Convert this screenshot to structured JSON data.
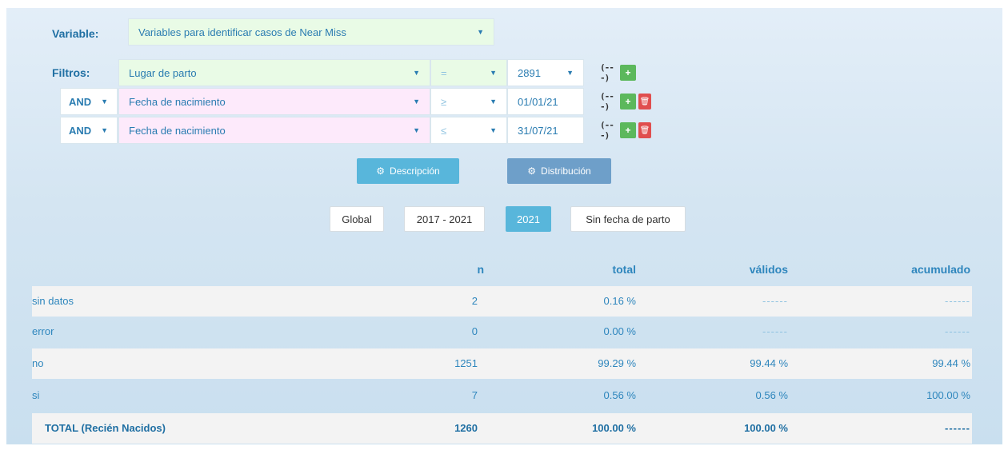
{
  "variable": {
    "label": "Variable:",
    "value": "Variables para identificar casos de Near Miss"
  },
  "filters": {
    "label": "Filtros:",
    "rows": [
      {
        "connector": "",
        "field": "Lugar de parto",
        "operator": "=",
        "value": "2891"
      },
      {
        "connector": "AND",
        "field": "Fecha de nacimiento",
        "operator": "≥",
        "value": "01/01/21"
      },
      {
        "connector": "AND",
        "field": "Fecha de nacimiento",
        "operator": "≤",
        "value": "31/07/21"
      }
    ],
    "fx_glyph": "(---)",
    "add_glyph": "+",
    "delete_glyph": "🗑"
  },
  "actions": {
    "descripcion": "Descripción",
    "distribucion": "Distribución"
  },
  "period_tabs": [
    {
      "label": "Global",
      "active": false
    },
    {
      "label": "2017 - 2021",
      "active": false
    },
    {
      "label": "2021",
      "active": true
    },
    {
      "label": "Sin fecha de parto",
      "active": false
    }
  ],
  "table": {
    "headers": {
      "n": "n",
      "total": "total",
      "validos": "válidos",
      "acumulado": "acumulado"
    },
    "rows": [
      {
        "label": "sin datos",
        "n": "2",
        "total": "0.16 %",
        "validos": "------",
        "acumulado": "------"
      },
      {
        "label": "error",
        "n": "0",
        "total": "0.00 %",
        "validos": "------",
        "acumulado": "------"
      },
      {
        "label": "no",
        "n": "1251",
        "total": "99.29 %",
        "validos": "99.44 %",
        "acumulado": "99.44 %"
      },
      {
        "label": "si",
        "n": "7",
        "total": "0.56 %",
        "validos": "0.56 %",
        "acumulado": "100.00 %"
      }
    ],
    "total": {
      "label": "TOTAL (Recién Nacidos)",
      "n": "1260",
      "total": "100.00 %",
      "validos": "100.00 %",
      "acumulado": "------"
    }
  },
  "colors": {
    "accent": "#58b6db",
    "add_green": "#5cb85c",
    "delete_red": "#e04e4e",
    "field_green_bg": "#e9fbe6",
    "field_pink_bg": "#fdeafb"
  }
}
